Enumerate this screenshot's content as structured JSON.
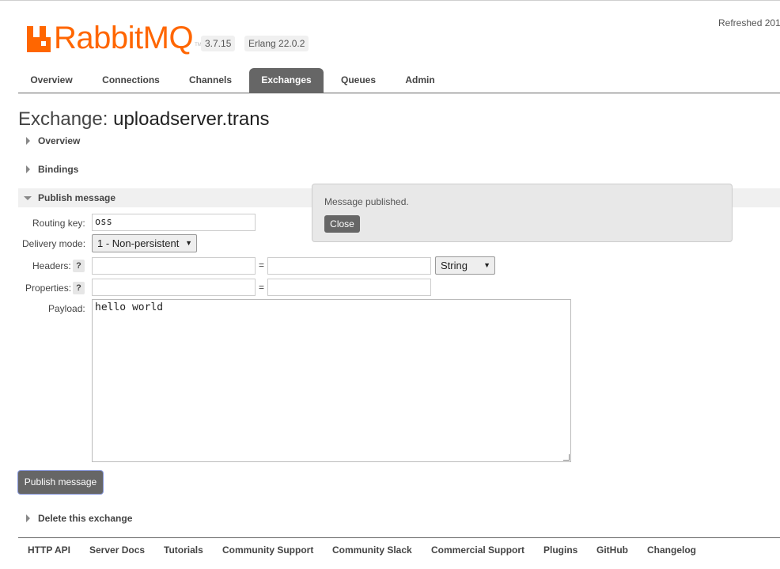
{
  "header": {
    "brand": "RabbitMQ",
    "tm": "TM",
    "version": "3.7.15",
    "erlang": "Erlang 22.0.2",
    "refreshed": "Refreshed 201",
    "brand_color": "#ff6600"
  },
  "tabs": [
    {
      "label": "Overview",
      "active": false
    },
    {
      "label": "Connections",
      "active": false
    },
    {
      "label": "Channels",
      "active": false
    },
    {
      "label": "Exchanges",
      "active": true
    },
    {
      "label": "Queues",
      "active": false
    },
    {
      "label": "Admin",
      "active": false
    }
  ],
  "page": {
    "title_prefix": "Exchange:",
    "exchange_name": "uploadserver.trans"
  },
  "sections": {
    "overview": "Overview",
    "bindings": "Bindings",
    "publish": "Publish message",
    "delete": "Delete this exchange"
  },
  "publish_form": {
    "routing_key_label": "Routing key:",
    "routing_key_value": "oss",
    "delivery_mode_label": "Delivery mode:",
    "delivery_mode_value": "1 - Non-persistent",
    "headers_label": "Headers:",
    "properties_label": "Properties:",
    "help": "?",
    "equals": "=",
    "header_type_value": "String",
    "payload_label": "Payload:",
    "payload_value": "hello world",
    "submit_label": "Publish message"
  },
  "popup": {
    "message": "Message published.",
    "close_label": "Close"
  },
  "footer": [
    "HTTP API",
    "Server Docs",
    "Tutorials",
    "Community Support",
    "Community Slack",
    "Commercial Support",
    "Plugins",
    "GitHub",
    "Changelog"
  ]
}
